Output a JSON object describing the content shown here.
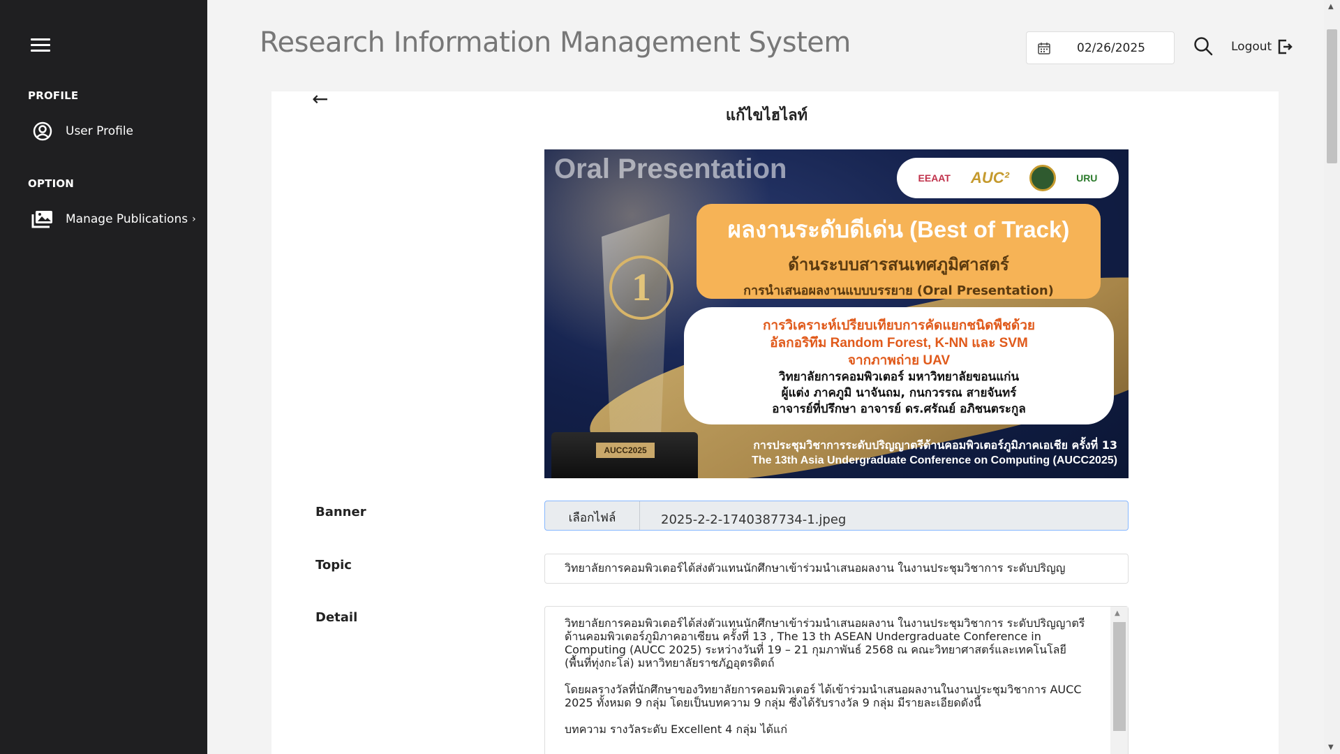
{
  "app": {
    "title": "Research Information Management System"
  },
  "header": {
    "date": "02/26/2025",
    "logout_label": "Logout"
  },
  "sidebar": {
    "section_profile": "PROFILE",
    "user_profile": "User Profile",
    "section_option": "OPTION",
    "manage_publications": "Manage Publications"
  },
  "page": {
    "title": "แก้ไขไฮไลท์"
  },
  "banner_image": {
    "oral": "Oral Presentation",
    "logos": [
      "EEAAT",
      "AUC²",
      "URU"
    ],
    "award_line1": "ผลงานระดับดีเด่น (Best of Track)",
    "award_line2": "ด้านระบบสารสนเทศภูมิศาสตร์",
    "award_line3": "การนำเสนอผลงานแบบบรรยาย (Oral Presentation)",
    "paper_title_1": "การวิเคราะห์เปรียบเทียบการคัดแยกชนิดพืชด้วย",
    "paper_title_2": "อัลกอริทึม Random Forest, K-NN และ SVM",
    "paper_title_3": "จากภาพถ่าย UAV",
    "college": "วิทยาลัยการคอมพิวเตอร์ มหาวิทยาลัยขอนแก่น",
    "authors": "ผู้แต่ง ภาคภูมิ นาจันถม, กนกวรรณ สายจันทร์",
    "advisor": "อาจารย์ที่ปรึกษา อาจารย์ ดร.ศรัณย์ อภิชนตระกูล",
    "conference_th": "การประชุมวิชาการระดับปริญญาตรีด้านคอมพิวเตอร์ภูมิภาคเอเชีย ครั้งที่ 13",
    "conference_en": "The 13th Asia Undergraduate Conference on Computing (AUCC2025)",
    "trophy_number": "1",
    "trophy_plate": "AUCC2025"
  },
  "form": {
    "banner_label": "Banner",
    "file_button": "เลือกไฟล์",
    "file_name": "2025-2-2-1740387734-1.jpeg",
    "topic_label": "Topic",
    "topic_value": "วิทยาลัยการคอมพิวเตอร์ได้ส่งตัวแทนนักศึกษาเข้าร่วมนำเสนอผลงาน ในงานประชุมวิชาการ ระดับปริญญ",
    "detail_label": "Detail",
    "detail_p1": "วิทยาลัยการคอมพิวเตอร์ได้ส่งตัวแทนนักศึกษาเข้าร่วมนำเสนอผลงาน ในงานประชุมวิชาการ ระดับปริญญาตรีด้านคอมพิวเตอร์ภูมิภาคอาเซียน ครั้งที่ 13 , The 13 th ASEAN Undergraduate Conference in Computing (AUCC 2025) ระหว่างวันที่ 19 – 21 กุมภาพันธ์ 2568 ณ คณะวิทยาศาสตร์และเทคโนโลยี (พื้นที่ทุ่งกะโล่) มหาวิทยาลัยราชภัฏอุตรดิตถ์",
    "detail_p2": "โดยผลรางวัลที่นักศึกษาของวิทยาลัยการคอมพิวเตอร์ ได้เข้าร่วมนำเสนอผลงานในงานประชุมวิชาการ AUCC 2025 ทั้งหมด 9 กลุ่ม โดยเป็นบทความ 9 กลุ่ม ซึ่งได้รับรางวัล 9 กลุ่ม มีรายละเอียดดังนี้",
    "detail_p3": "บทความ รางวัลระดับ Excellent 4 กลุ่ม ได้แก่"
  }
}
